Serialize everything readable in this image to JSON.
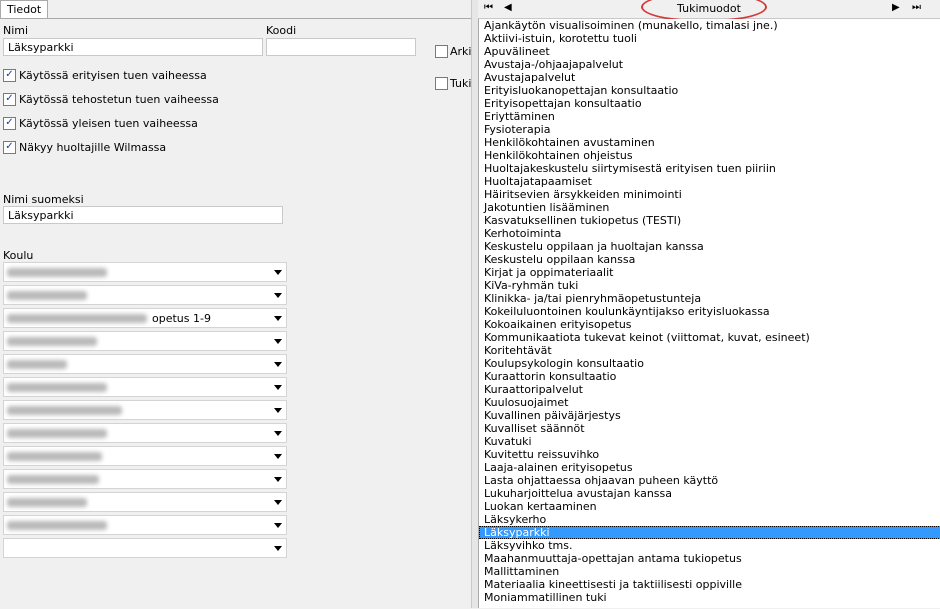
{
  "tabs": {
    "details": "Tiedot"
  },
  "form": {
    "name_label": "Nimi",
    "name_value": "Läksyparkki",
    "code_label": "Koodi",
    "code_value": "",
    "archived_label": "Arki",
    "tuki_label": "Tuki",
    "checkboxes": [
      {
        "label": "Käytössä erityisen tuen vaiheessa",
        "checked": true
      },
      {
        "label": "Käytössä tehostetun tuen vaiheessa",
        "checked": true
      },
      {
        "label": "Käytössä yleisen tuen vaiheessa",
        "checked": true
      },
      {
        "label": "Näkyy huoltajille Wilmassa",
        "checked": true
      }
    ],
    "finnish_name_label": "Nimi suomeksi",
    "finnish_name_value": "Läksyparkki",
    "school_label": "Koulu",
    "school_partial_text": "opetus 1-9"
  },
  "right": {
    "title": "Tukimuodot",
    "nav_first": "⏮",
    "nav_prev": "◀",
    "nav_next": "▶",
    "nav_last": "⏭",
    "selected": "Läksyparkki",
    "items": [
      "Ajankäytön visualisoiminen (munakello, timalasi jne.)",
      "Aktiivi-istuin, korotettu tuoli",
      "Apuvälineet",
      "Avustaja-/ohjaajapalvelut",
      "Avustajapalvelut",
      "Erityisluokanopettajan konsultaatio",
      "Erityisopettajan konsultaatio",
      "Eriyttäminen",
      "Fysioterapia",
      "Henkilökohtainen avustaminen",
      "Henkilökohtainen ohjeistus",
      "Huoltajakeskustelu siirtymisestä erityisen tuen piiriin",
      "Huoltajatapaamiset",
      "Häiritsevien ärsykkeiden minimointi",
      "Jakotuntien lisääminen",
      "Kasvatuksellinen tukiopetus (TESTI)",
      "Kerhotoiminta",
      "Keskustelu oppilaan ja huoltajan kanssa",
      "Keskustelu oppilaan kanssa",
      "Kirjat ja oppimateriaalit",
      "KiVa-ryhmän tuki",
      "Klinikka- ja/tai pienryhmäopetustunteja",
      "Kokeiluluontoinen koulunkäyntijakso erityisluokassa",
      "Kokoaikainen erityisopetus",
      "Kommunikaatiota tukevat keinot (viittomat, kuvat, esineet)",
      "Koritehtävät",
      "Koulupsykologin konsultaatio",
      "Kuraattorin konsultaatio",
      "Kuraattoripalvelut",
      "Kuulosuojaimet",
      "Kuvallinen päiväjärjestys",
      "Kuvalliset säännöt",
      "Kuvatuki",
      "Kuvitettu reissuvihko",
      "Laaja-alainen erityisopetus",
      "Lasta ohjattaessa ohjaavan puheen käyttö",
      "Lukuharjoittelua avustajan kanssa",
      "Luokan kertaaminen",
      "Läksykerho",
      "Läksyparkki",
      "Läksyvihko tms.",
      "Maahanmuuttaja-opettajan antama tukiopetus",
      "Mallittaminen",
      "Materiaalia kineettisesti ja taktiilisesti oppiville",
      "Moniammatillinen tuki"
    ]
  },
  "colors": {
    "selection": "#3399ff",
    "annotation": "#d23a3a",
    "check": "#1a3d8c"
  }
}
